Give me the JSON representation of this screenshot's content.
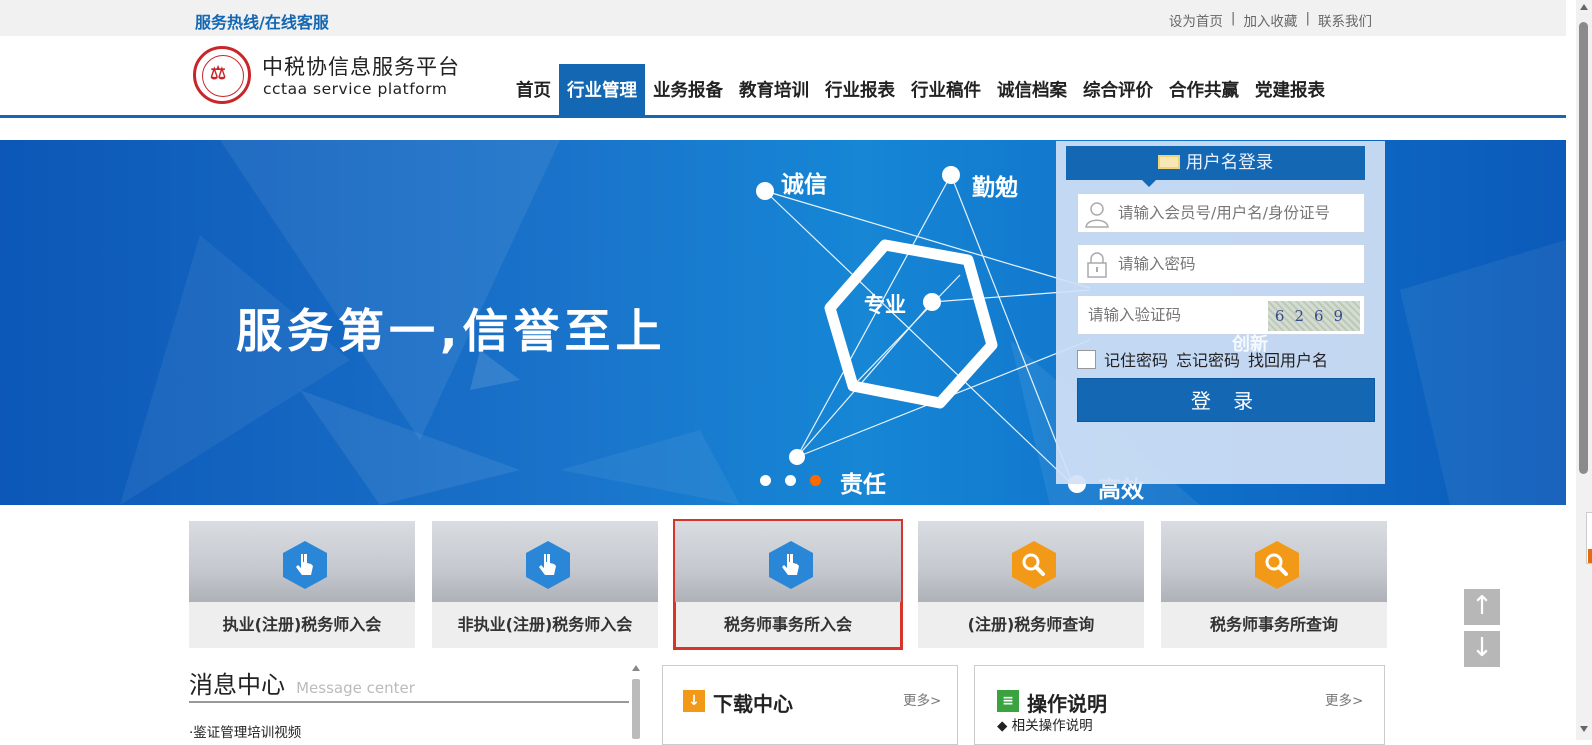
{
  "topbar": {
    "hotline": "服务热线/在线客服",
    "links": [
      "设为首页",
      "加入收藏",
      "联系我们"
    ],
    "separator": "|"
  },
  "logo": {
    "cn": "中税协信息服务平台",
    "en": "cctaa  service platform"
  },
  "nav": {
    "items": [
      "首页",
      "行业管理",
      "业务报备",
      "教育培训",
      "行业报表",
      "行业稿件",
      "诚信档案",
      "综合评价",
      "合作共赢",
      "党建报表"
    ],
    "active": "行业管理"
  },
  "banner": {
    "slogan": "服务第一,信誉至上",
    "keywords": {
      "k1": "诚信",
      "k2": "勤勉",
      "k3": "专业",
      "k4": "责任",
      "k5": "高效",
      "k6": "创新"
    },
    "slide_count": 3,
    "active_slide": 3,
    "active_dot_color": "#ff6a00"
  },
  "login": {
    "title": "用户名登录",
    "username_placeholder": "请输入会员号/用户名/身份证号",
    "password_placeholder": "请输入密码",
    "captcha_placeholder": "请输入验证码",
    "captcha_text": "6269",
    "remember": "记住密码",
    "forgot": "忘记密码",
    "recover": "找回用户名",
    "submit": "登 录"
  },
  "cards": [
    {
      "label": "执业(注册)税务师入会",
      "icon": "hand-pointer-icon",
      "hex_color": "#2a86d6"
    },
    {
      "label": "非执业(注册)税务师入会",
      "icon": "hand-pointer-icon",
      "hex_color": "#2a86d6"
    },
    {
      "label": "税务师事务所入会",
      "icon": "hand-pointer-icon",
      "hex_color": "#2a86d6"
    },
    {
      "label": "(注册)税务师查询",
      "icon": "magnifier-icon",
      "hex_color": "#f29a17"
    },
    {
      "label": "税务师事务所查询",
      "icon": "magnifier-icon",
      "hex_color": "#f29a17"
    }
  ],
  "side_buttons": {
    "up": "↑",
    "down": "↓"
  },
  "message_center": {
    "title": "消息中心",
    "subtitle": "Message center",
    "first_item": "·鉴证管理培训视频"
  },
  "download": {
    "title": "下载中心",
    "more": "更多>",
    "icon": "download-arrow-icon"
  },
  "guide": {
    "title": "操作说明",
    "more": "更多>",
    "sub": "◆  相关操作说明",
    "icon": "document-icon"
  },
  "colors": {
    "brand_blue": "#1467b3",
    "seal_red": "#c9262b",
    "card_highlight": "#d8352a"
  }
}
